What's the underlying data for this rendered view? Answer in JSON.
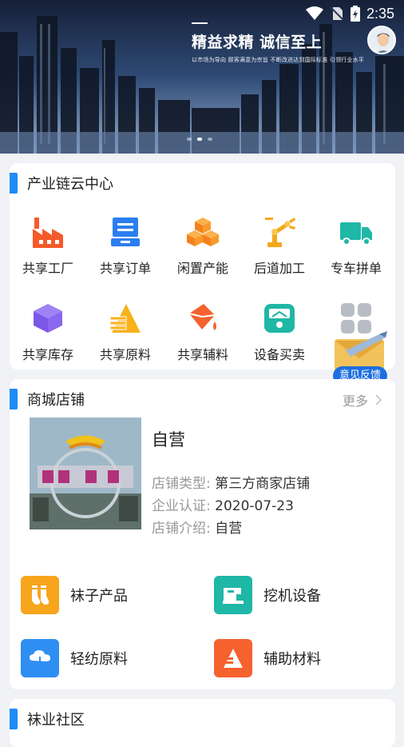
{
  "status": {
    "time": "2:35"
  },
  "banner": {
    "slogan": "精益求精 诚信至上",
    "sub": "以市场为导向 顾客满意为宗旨 不断改进达到国际标准 引领行业水平"
  },
  "industry": {
    "title": "产业链云中心",
    "items": [
      {
        "label": "共享工厂",
        "icon": "factory-icon"
      },
      {
        "label": "共享订单",
        "icon": "order-icon"
      },
      {
        "label": "闲置产能",
        "icon": "boxes-icon"
      },
      {
        "label": "后道加工",
        "icon": "robot-arm-icon"
      },
      {
        "label": "专车拼单",
        "icon": "truck-icon"
      },
      {
        "label": "共享库存",
        "icon": "cube-icon"
      },
      {
        "label": "共享原料",
        "icon": "material-icon"
      },
      {
        "label": "共享辅料",
        "icon": "paint-bucket-icon"
      },
      {
        "label": "设备买卖",
        "icon": "scale-icon"
      },
      {
        "label": "",
        "icon": "grid-more-icon"
      }
    ]
  },
  "feedback": {
    "label": "意见反馈"
  },
  "store": {
    "title": "商城店铺",
    "more": "更多",
    "shop": {
      "name": "自营",
      "type_label": "店铺类型:",
      "type_value": "第三方商家店铺",
      "cert_label": "企业认证:",
      "cert_value": "2020-07-23",
      "intro_label": "店铺介绍:",
      "intro_value": "自营"
    },
    "categories": [
      {
        "label": "袜子产品",
        "icon": "sock-icon",
        "color": "#f7a51c"
      },
      {
        "label": "挖机设备",
        "icon": "sewing-machine-icon",
        "color": "#1fb7a6"
      },
      {
        "label": "轻纺原料",
        "icon": "cotton-icon",
        "color": "#2f8ef2"
      },
      {
        "label": "辅助材料",
        "icon": "material-stack-icon",
        "color": "#f5622e"
      }
    ]
  },
  "community": {
    "title": "袜业社区"
  }
}
